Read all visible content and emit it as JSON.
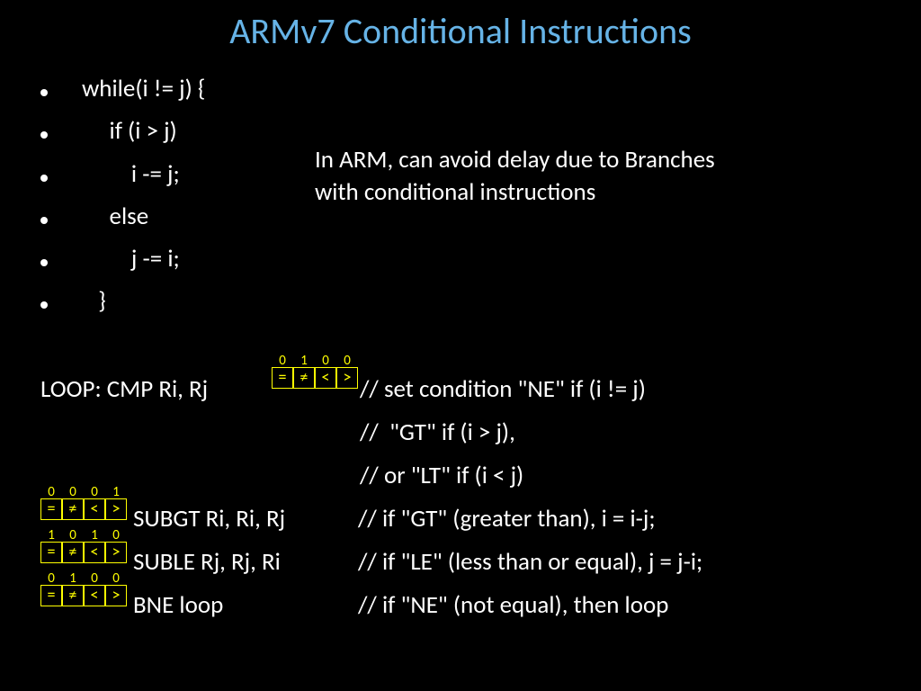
{
  "title": "ARMv7 Conditional Instructions",
  "code_bullets": [
    "while(i != j) {",
    "     if (i > j)",
    "         i -= j;",
    "     else",
    "         j -= i;",
    "   }"
  ],
  "explain": "In ARM, can avoid delay due to Branches with conditional instructions",
  "asm": {
    "line1_instr": "LOOP: CMP Ri, Rj",
    "line1_comment": "// set condition \"NE\" if (i != j)",
    "line2_comment": "//  \"GT\" if (i > j),",
    "line3_comment": "// or \"LT\" if (i < j)",
    "line4_instr": "SUBGT Ri, Ri, Rj",
    "line4_comment": "// if \"GT\" (greater than), i = i-j;",
    "line5_instr": "SUBLE Rj, Rj, Ri",
    "line5_comment": "// if \"LE\" (less than or equal), j = j-i;",
    "line6_instr": "BNE loop",
    "line6_comment": "// if \"NE\" (not equal), then loop"
  },
  "flag_symbols": [
    "=",
    "≠",
    "<",
    ">"
  ],
  "flag_bits": {
    "cmp": [
      "0",
      "1",
      "0",
      "0"
    ],
    "subgt": [
      "0",
      "0",
      "0",
      "1"
    ],
    "suble": [
      "1",
      "0",
      "1",
      "0"
    ],
    "bne": [
      "0",
      "1",
      "0",
      "0"
    ]
  }
}
